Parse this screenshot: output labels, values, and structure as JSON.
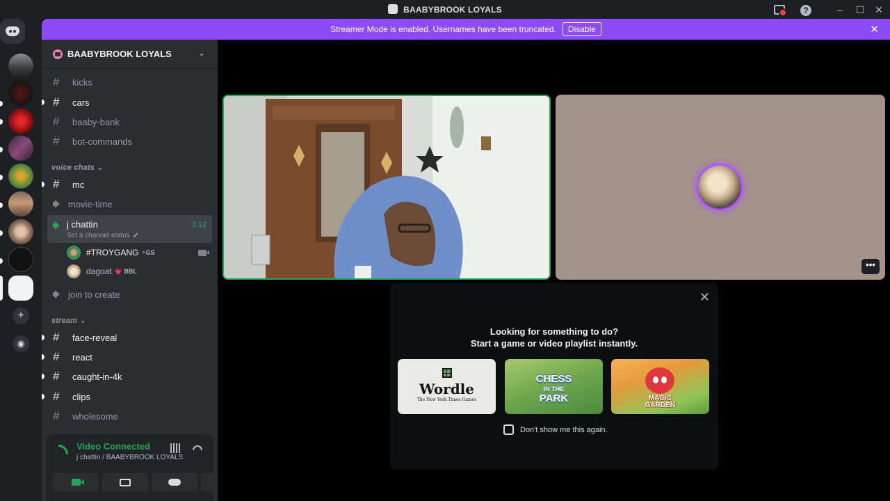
{
  "window": {
    "title": "BAABYBROOK LOYALS",
    "min": "–",
    "max": "☐",
    "close": "✕"
  },
  "banner": {
    "text": "Streamer Mode is enabled. Usernames have been truncated.",
    "button": "Disable",
    "close": "✕"
  },
  "guild": {
    "name": "BAABYBROOK LOYALS",
    "chevron": "⌄"
  },
  "channels": {
    "kicks": "kicks",
    "cars": "cars",
    "baaby_bank": "baaby-bank",
    "bot_commands": "bot-commands",
    "cat_voice": "voice chats ⌄",
    "mc": "mc",
    "movie_time": "movie-time",
    "vc_name": "j chattin",
    "vc_status": "Set a channel status",
    "vc_time": "3:12",
    "user1": "#TROYGANG",
    "user1_tag": "⚡GS",
    "user2": "dagoat",
    "user2_tag": "💗 BBL",
    "join_create": "join to create",
    "cat_stream": "stream ⌄",
    "face_reveal": "face-reveal",
    "react": "react",
    "caught": "caught-in-4k",
    "clips": "clips",
    "wholesome": "wholesome",
    "hash": "#"
  },
  "voice_panel": {
    "title": "Video Connected",
    "subtitle": "j chattin / BAABYBROOK LOYALS",
    "below_user": "#TROYGANG"
  },
  "activity": {
    "line1": "Looking for something to do?",
    "line2": "Start a game or video playlist instantly.",
    "cards": {
      "wordle": "Wordle",
      "wordle_sub": "The New York Times Games",
      "chess_top": "CHESS",
      "chess_mid": "IN THE",
      "chess_bottom": "PARK",
      "garden_top": "MAGIC",
      "garden_bottom": "GARDEN"
    },
    "checkbox": "Don't show me this again.",
    "close": "✕"
  },
  "tile_more": "•••",
  "colors": {
    "accent": "#8c4bf7",
    "green": "#23a55a",
    "speaking_ring": "#b057f9"
  }
}
